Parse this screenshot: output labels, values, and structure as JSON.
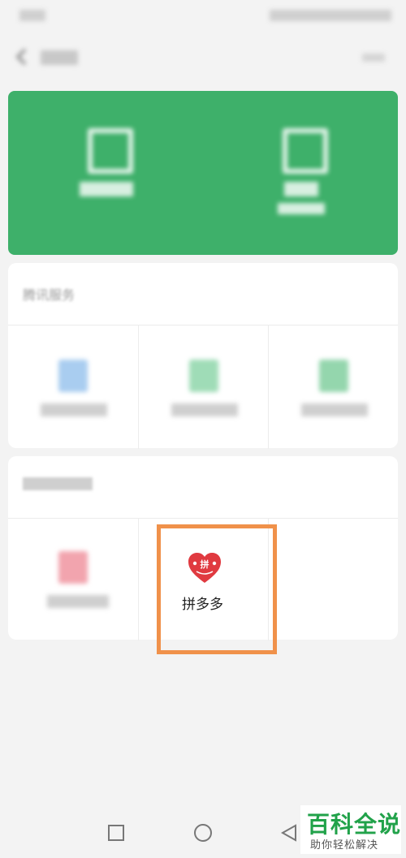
{
  "sections": {
    "tencent_title": "腾讯服务"
  },
  "third_party": {
    "pinduoduo_label": "拼多多",
    "pinduoduo_badge": "拼"
  },
  "watermark": {
    "big": "百科全说",
    "small": "助你轻松解决"
  },
  "colors": {
    "wallet_green": "#3eb06a",
    "highlight_orange": "#f0914a",
    "pinduoduo_red": "#e03a40"
  },
  "icons": {
    "back": "back-arrow-icon",
    "more": "more-icon",
    "pay": "qr-pay-icon",
    "wallet": "wallet-icon",
    "pinduoduo": "pinduoduo-logo-icon"
  }
}
